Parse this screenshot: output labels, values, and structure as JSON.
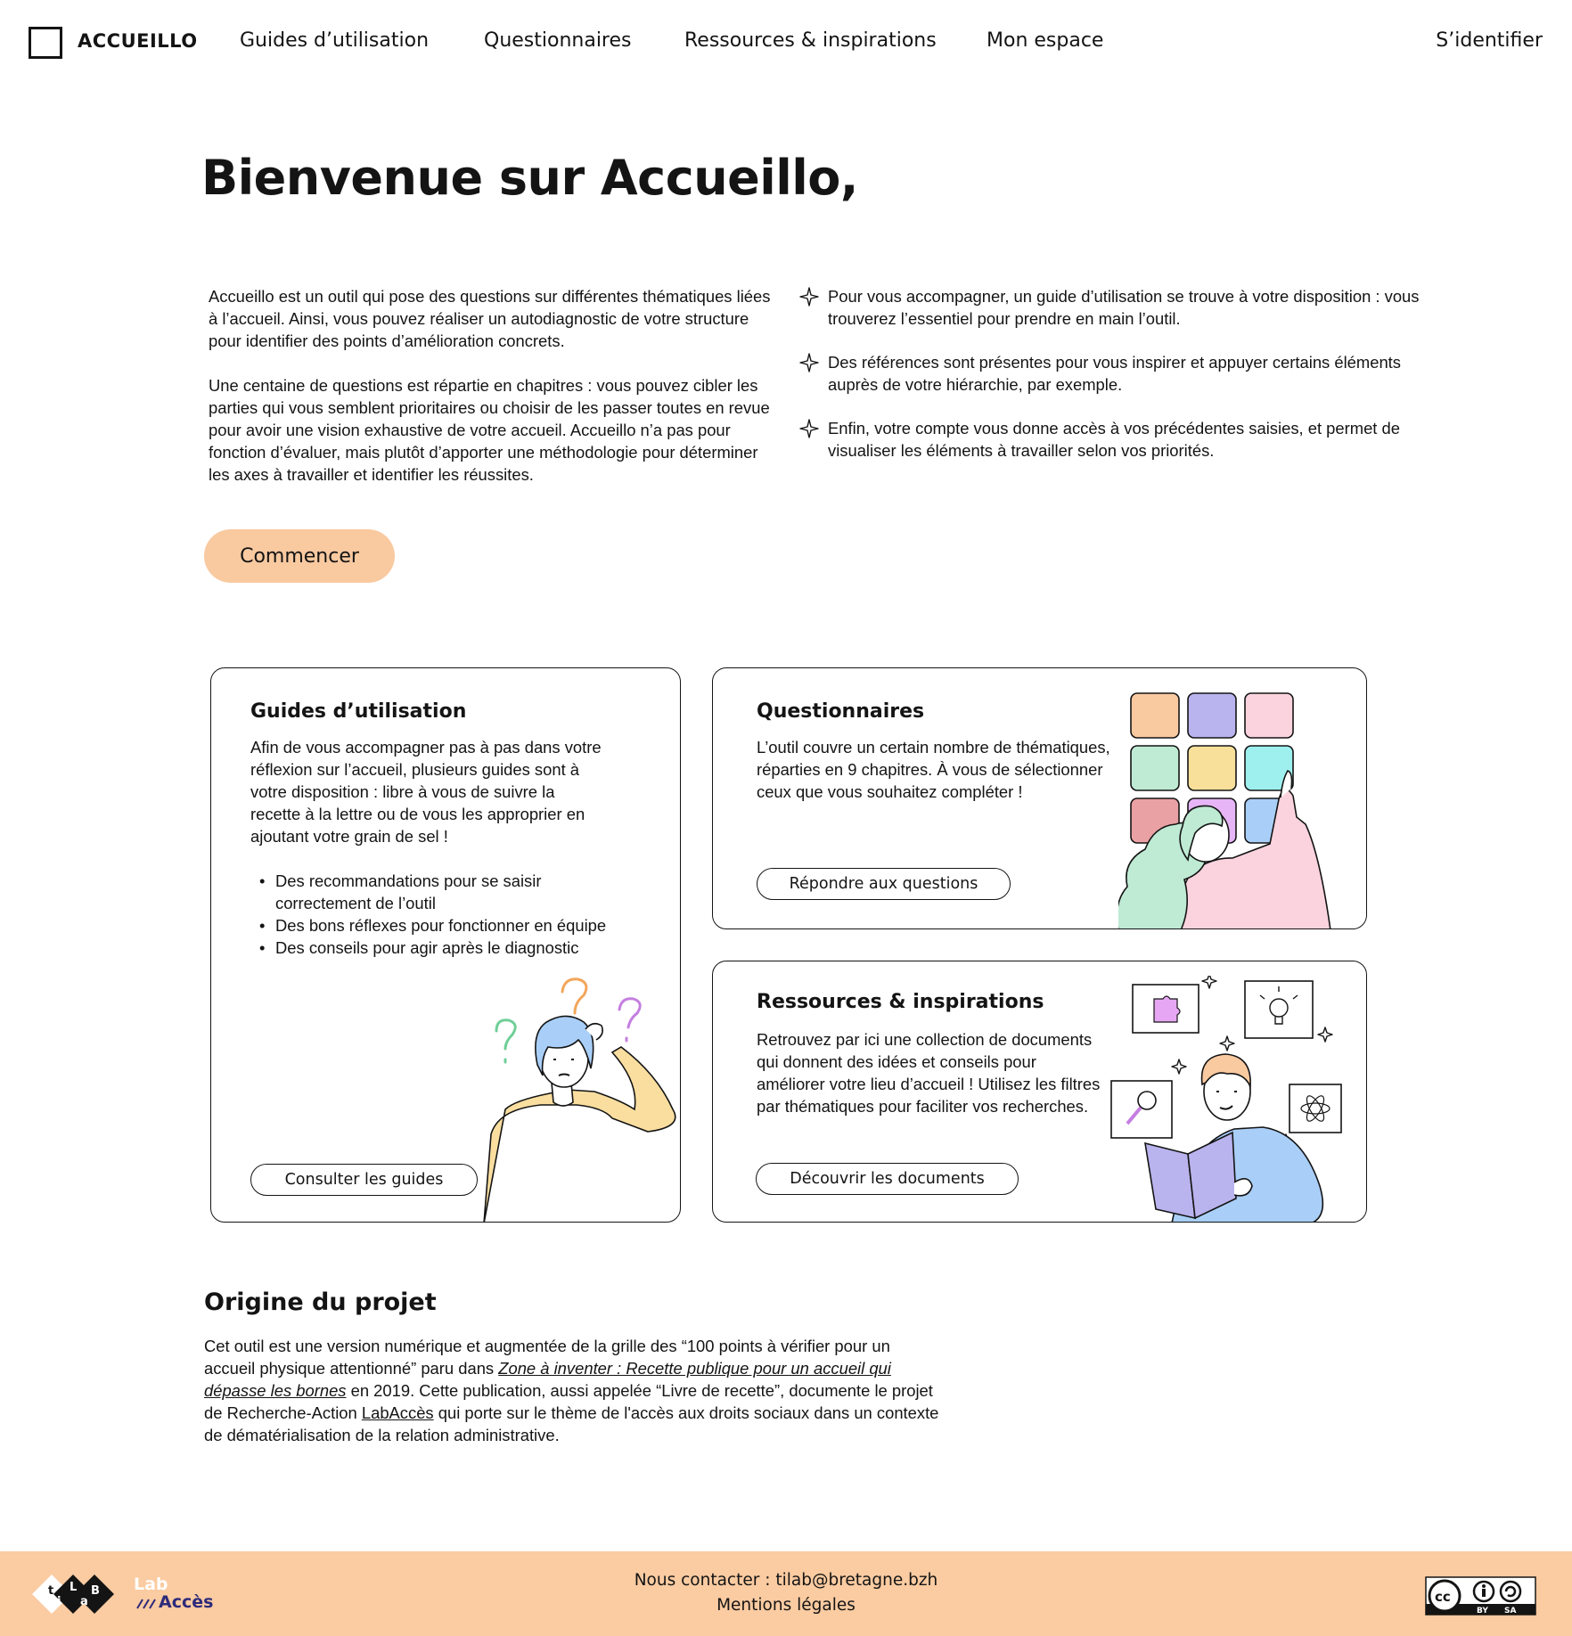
{
  "nav": {
    "brand": "ACCUEILLO",
    "links": [
      "Guides d’utilisation",
      "Questionnaires",
      "Ressources & inspirations",
      "Mon espace"
    ],
    "login": "S’identifier"
  },
  "hero": {
    "title": "Bienvenue sur Accueillo,",
    "intro": [
      "Accueillo est un outil qui pose des questions sur différentes thématiques liées à l’accueil. Ainsi, vous pouvez réaliser un autodiagnostic de votre structure pour identifier des points d’amélioration concrets.",
      "Une centaine de questions est répartie en chapitres : vous pouvez cibler les parties qui vous semblent prioritaires ou choisir de les passer toutes en revue pour avoir une vision exhaustive de votre accueil.  Accueillo n’a pas pour fonction d’évaluer, mais plutôt d’apporter une méthodologie pour déterminer les axes à travailler et identifier les réussites."
    ],
    "bullets": [
      "Pour vous accompagner, un guide d’utilisation se trouve à votre disposition : vous trouverez l’essentiel pour prendre en main l’outil.",
      "Des références sont présentes pour vous inspirer et appuyer certains éléments auprès de votre hiérarchie, par exemple.",
      "Enfin, votre compte vous donne accès à vos précédentes saisies, et permet de visualiser les éléments à travailler selon vos priorités."
    ],
    "cta": "Commencer"
  },
  "cards": {
    "guides": {
      "title": "Guides d’utilisation",
      "text": "Afin de vous accompagner pas à pas dans votre réflexion sur l’accueil, plusieurs guides sont à votre disposition : libre à vous de suivre la recette à la lettre ou de vous les approprier en ajoutant votre grain de sel !",
      "items": [
        "Des recommandations pour se saisir correctement de l’outil",
        "Des bons réflexes pour fonctionner en équipe",
        "Des conseils pour agir après le diagnostic"
      ],
      "button": "Consulter les guides"
    },
    "questionnaires": {
      "title": "Questionnaires",
      "text": "L’outil couvre un certain nombre de thématiques, réparties en 9 chapitres. À vous de sélectionner ceux que vous souhaitez compléter !",
      "button": "Répondre aux questions",
      "tile_colors": [
        "#f9c9a0",
        "#b9b4ee",
        "#fbd3de",
        "#bfead4",
        "#f8e09b",
        "#9ef0ee",
        "#eaa1a4",
        "#e6b5f6",
        "#a9cff8"
      ]
    },
    "ressources": {
      "title": "Ressources & inspirations",
      "text": "Retrouvez par ici une collection de documents qui donnent des idées et conseils pour améliorer votre lieu d’accueil ! Utilisez les filtres par thématiques pour faciliter vos recherches.",
      "button": "Découvrir les documents"
    }
  },
  "origin": {
    "title": "Origine du projet",
    "text_1": "Cet outil est une version numérique et augmentée de la grille des “100 points à vérifier pour un accueil physique attentionné” paru dans ",
    "ref": "Zone à inventer : Recette publique pour un accueil qui dépasse les bornes",
    "text_2": " en 2019. Cette publication, aussi appelée “Livre de recette”, documente le projet de Recherche-Action ",
    "link": "LabAccès",
    "text_3": " qui porte sur le thème de l'accès aux droits sociaux dans un contexte de dématérialisation de la relation administrative."
  },
  "footer": {
    "contact": "Nous contacter : tilab@bretagne.bzh",
    "legal": "Mentions légales",
    "logo_letters": [
      "t",
      "i",
      "L",
      "a",
      "B"
    ],
    "labacces_lab": "Lab",
    "labacces_acces": "Accès",
    "license": [
      "BY",
      "SA"
    ],
    "bg_color": "#fbcba1"
  },
  "colors": {
    "accent": "#f9c9a0",
    "ink": "#141414"
  }
}
